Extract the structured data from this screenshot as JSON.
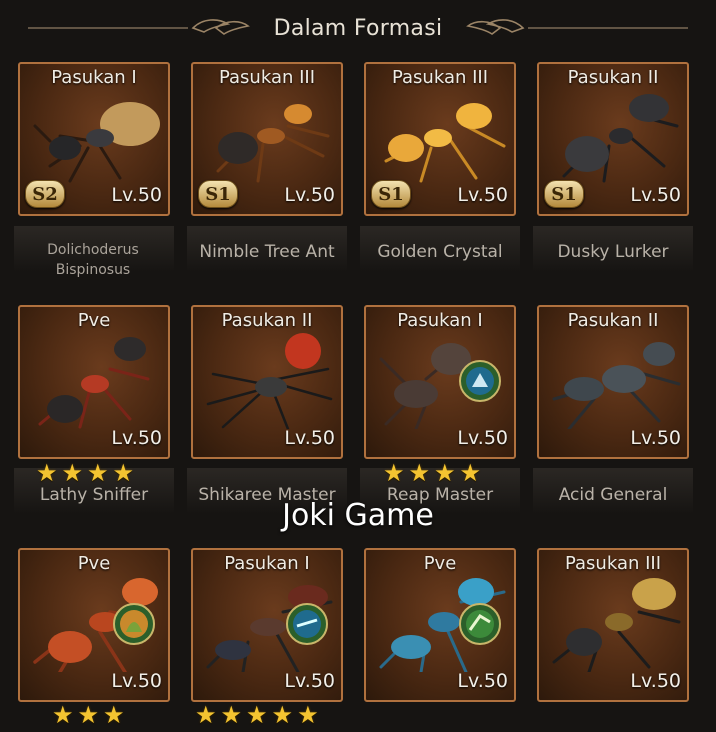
{
  "header": {
    "title": "Dalam Formasi"
  },
  "watermark": "Joki Game",
  "cards": [
    {
      "title": "Pasukan I",
      "level": "Lv.50",
      "season": "S2",
      "name": "Dolichoderus Bispinosus",
      "stars": 0
    },
    {
      "title": "Pasukan III",
      "level": "Lv.50",
      "season": "S1",
      "name": "Nimble Tree Ant",
      "stars": 0
    },
    {
      "title": "Pasukan III",
      "level": "Lv.50",
      "season": "S1",
      "name": "Golden Crystal",
      "stars": 0
    },
    {
      "title": "Pasukan II",
      "level": "Lv.50",
      "season": "S1",
      "name": "Dusky Lurker",
      "stars": 0
    },
    {
      "title": "Pve",
      "level": "Lv.50",
      "name": "Lathy Sniffer",
      "stars": 4
    },
    {
      "title": "Pasukan II",
      "level": "Lv.50",
      "name": "Shikaree Master",
      "stars": 0
    },
    {
      "title": "Pasukan I",
      "level": "Lv.50",
      "name": "Reap Master",
      "stars": 4
    },
    {
      "title": "Pasukan II",
      "level": "Lv.50",
      "name": "Acid General",
      "stars": 0
    },
    {
      "title": "Pve",
      "level": "Lv.50",
      "stars": 3
    },
    {
      "title": "Pasukan I",
      "level": "Lv.50",
      "stars": 5
    },
    {
      "title": "Pve",
      "level": "Lv.50",
      "stars": 0
    },
    {
      "title": "Pasukan III",
      "level": "Lv.50",
      "stars": 0
    }
  ],
  "colors": {
    "border": "#b0713e",
    "star": "#f4c431",
    "background": "#161412"
  }
}
